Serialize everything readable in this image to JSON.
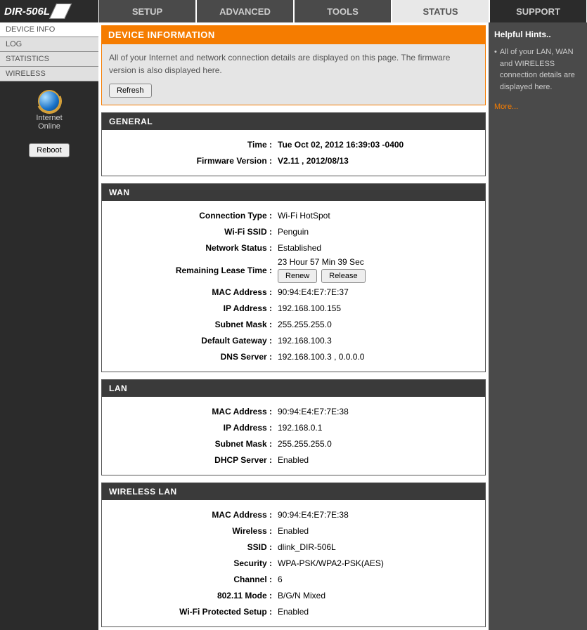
{
  "logo": "DIR-506L",
  "nav": {
    "setup": "SETUP",
    "advanced": "ADVANCED",
    "tools": "TOOLS",
    "status": "STATUS",
    "support": "SUPPORT"
  },
  "sidebar": {
    "device_info": "DEVICE INFO",
    "log": "LOG",
    "statistics": "STATISTICS",
    "wireless": "WIRELESS",
    "internet_label1": "Internet",
    "internet_label2": "Online",
    "reboot": "Reboot"
  },
  "device_info": {
    "title": "DEVICE INFORMATION",
    "desc": "All of your Internet and network connection details are displayed on this page. The firmware version is also displayed here.",
    "refresh": "Refresh"
  },
  "general": {
    "title": "GENERAL",
    "time_label": "Time :",
    "time_value": "Tue Oct 02, 2012 16:39:03 -0400",
    "fw_label": "Firmware Version :",
    "fw_value": "V2.11 , 2012/08/13"
  },
  "wan": {
    "title": "WAN",
    "conn_type_label": "Connection Type :",
    "conn_type_value": "Wi-Fi HotSpot",
    "ssid_label": "Wi-Fi SSID :",
    "ssid_value": "Penguin",
    "net_status_label": "Network Status :",
    "net_status_value": "Established",
    "lease_label": "Remaining Lease Time :",
    "lease_value": "23 Hour 57 Min 39 Sec",
    "renew": "Renew",
    "release": "Release",
    "mac_label": "MAC Address :",
    "mac_value": "90:94:E4:E7:7E:37",
    "ip_label": "IP Address :",
    "ip_value": "192.168.100.155",
    "mask_label": "Subnet Mask :",
    "mask_value": "255.255.255.0",
    "gw_label": "Default Gateway :",
    "gw_value": "192.168.100.3",
    "dns_label": "DNS Server :",
    "dns_value": "192.168.100.3 , 0.0.0.0"
  },
  "lan": {
    "title": "LAN",
    "mac_label": "MAC Address :",
    "mac_value": "90:94:E4:E7:7E:38",
    "ip_label": "IP Address :",
    "ip_value": "192.168.0.1",
    "mask_label": "Subnet Mask :",
    "mask_value": "255.255.255.0",
    "dhcp_label": "DHCP Server :",
    "dhcp_value": "Enabled"
  },
  "wlan": {
    "title": "WIRELESS LAN",
    "mac_label": "MAC Address :",
    "mac_value": "90:94:E4:E7:7E:38",
    "wireless_label": "Wireless :",
    "wireless_value": "Enabled",
    "ssid_label": "SSID :",
    "ssid_value": "dlink_DIR-506L",
    "sec_label": "Security :",
    "sec_value": "WPA-PSK/WPA2-PSK(AES)",
    "ch_label": "Channel :",
    "ch_value": "6",
    "mode_label": "802.11 Mode :",
    "mode_value": "B/G/N Mixed",
    "wps_label": "Wi-Fi Protected Setup :",
    "wps_value": "Enabled"
  },
  "hints": {
    "title": "Helpful Hints..",
    "bullet": "All of your LAN, WAN and WIRELESS connection details are displayed here.",
    "more": "More..."
  }
}
